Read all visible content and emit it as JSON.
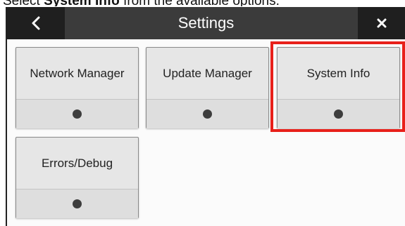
{
  "instruction": {
    "prefix": "Select ",
    "emphasis": "System Info",
    "suffix": " from the available options."
  },
  "header": {
    "title": "Settings",
    "back_icon": "chevron-left-icon",
    "close_icon": "close-icon"
  },
  "tiles": [
    {
      "label": "Network Manager",
      "status_icon": "status-dot-icon"
    },
    {
      "label": "Update Manager",
      "status_icon": "status-dot-icon"
    },
    {
      "label": "System Info",
      "status_icon": "status-dot-icon",
      "highlighted": true
    },
    {
      "label": "Errors/Debug",
      "status_icon": "status-dot-icon"
    }
  ],
  "colors": {
    "header_bg": "#3b3b3b",
    "header_button_bg": "#1f1f1f",
    "tile_bg": "#e6e6e6",
    "highlight": "#e8201a",
    "status_dot": "#3d3d3d"
  }
}
